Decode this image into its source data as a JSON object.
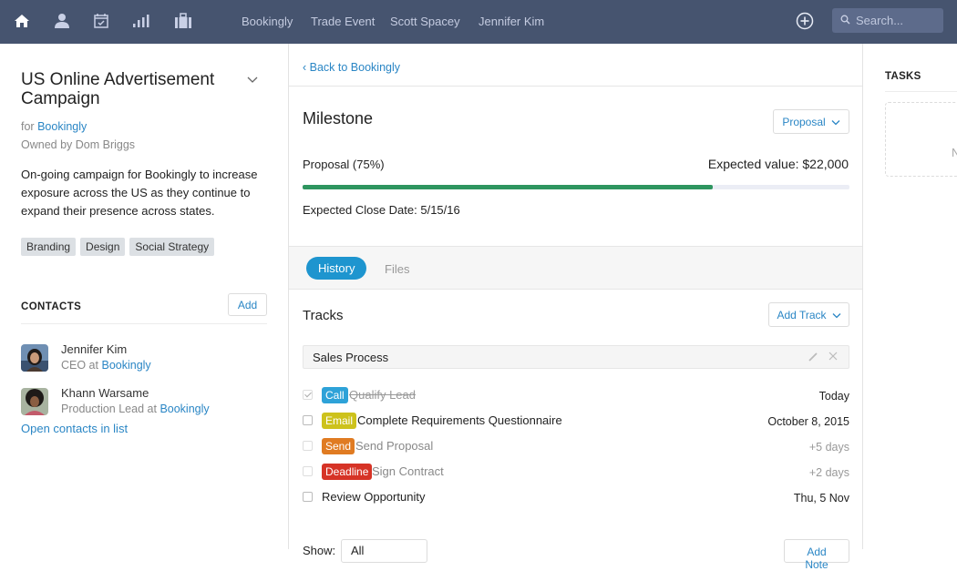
{
  "topbar": {
    "icons": [
      "home-icon",
      "person-icon",
      "calendar-icon",
      "bar-chart-icon",
      "briefcase-icon"
    ],
    "links": [
      "Bookingly",
      "Trade Event",
      "Scott Spacey",
      "Jennifer Kim"
    ],
    "search": {
      "placeholder": "Search..."
    }
  },
  "deal": {
    "title": "US Online Advertisement Campaign",
    "for_prefix": "for",
    "company": "Bookingly",
    "owner": "Owned by Dom Briggs",
    "description": "On-going campaign for Bookingly to increase exposure across the US as they continue to expand their presence across states.",
    "tags": [
      "Branding",
      "Design",
      "Social Strategy"
    ]
  },
  "contacts": {
    "heading": "CONTACTS",
    "add_label": "Add",
    "items": [
      {
        "name": "Jennifer Kim",
        "role": "CEO at",
        "company": "Bookingly"
      },
      {
        "name": "Khann Warsame",
        "role": "Production Lead at",
        "company": "Bookingly"
      }
    ],
    "open_list_label": "Open contacts in list"
  },
  "center": {
    "back_label": "‹ Back to Bookingly",
    "milestone_title": "Milestone",
    "stage_button": "Proposal",
    "stage_label": "Proposal (75%)",
    "progress_percent": 75,
    "expected_value": "Expected value: $22,000",
    "close_date": "Expected Close Date: 5/15/16",
    "tabs": [
      {
        "label": "History",
        "active": true
      },
      {
        "label": "Files",
        "active": false
      }
    ],
    "tracks_title": "Tracks",
    "add_track_label": "Add Track",
    "track_name": "Sales Process",
    "tasks": [
      {
        "checked": true,
        "badge": "Call",
        "badge_color": "#2ea2d8",
        "text": "Qualify Lead",
        "state": "done",
        "date": "Today"
      },
      {
        "checked": false,
        "badge": "Email",
        "badge_color": "#cdc21c",
        "text": "Complete Requirements Questionnaire",
        "state": "active",
        "date": "October 8, 2015"
      },
      {
        "checked": false,
        "badge": "Send",
        "badge_color": "#e07b22",
        "text": "Send Proposal",
        "state": "muted",
        "date": "+5 days"
      },
      {
        "checked": false,
        "badge": "Deadline",
        "badge_color": "#d63326",
        "text": "Sign Contract",
        "state": "muted",
        "date": "+2 days"
      },
      {
        "checked": false,
        "badge": "",
        "badge_color": "",
        "text": "Review Opportunity",
        "state": "active",
        "date": "Thu, 5 Nov"
      }
    ],
    "show_label": "Show:",
    "show_value": "All",
    "add_note_label": "Add Note"
  },
  "right": {
    "tasks_heading": "TASKS",
    "empty_text": "N"
  }
}
